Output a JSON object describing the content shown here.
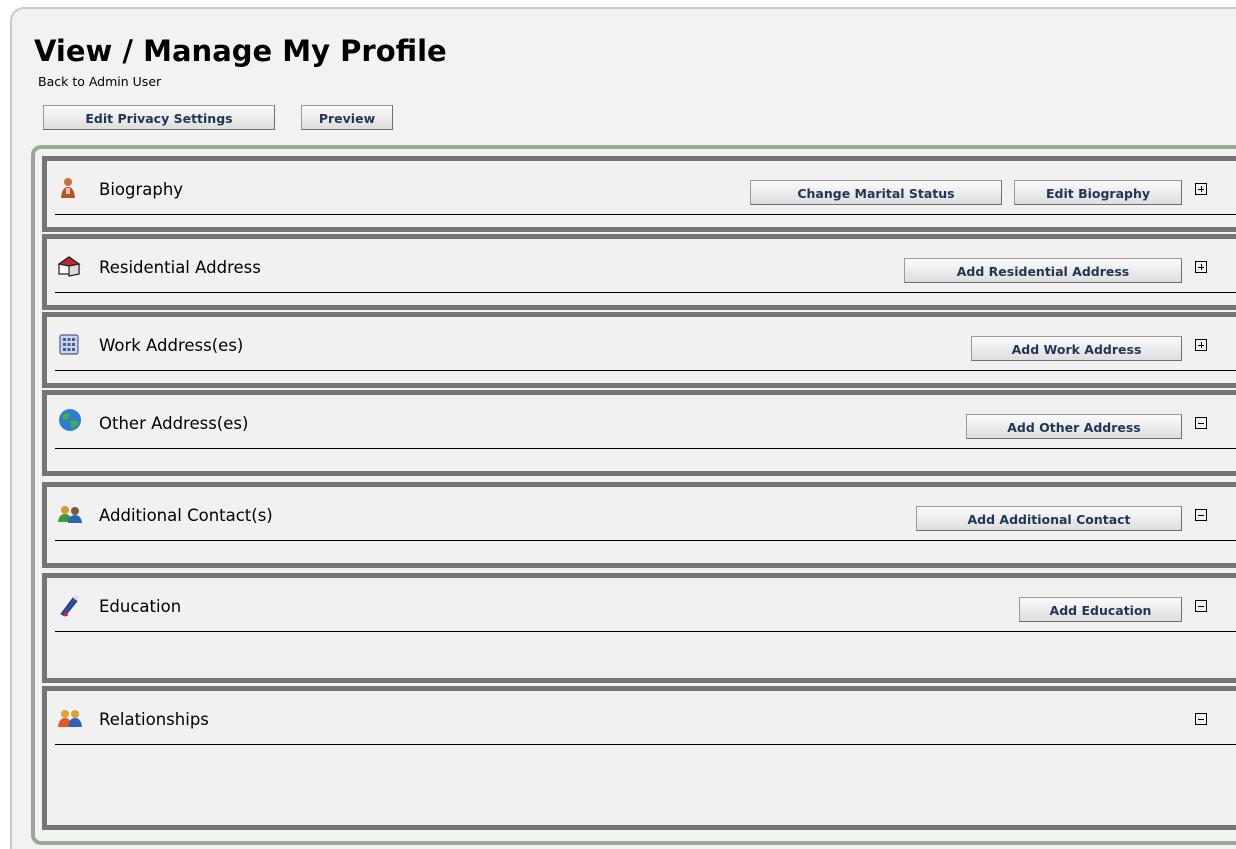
{
  "page": {
    "title": "View / Manage My Profile",
    "back_link": "Back to Admin User",
    "buttons": {
      "edit_privacy": "Edit Privacy Settings",
      "preview": "Preview"
    }
  },
  "sections": [
    {
      "title": "Biography",
      "icon": "person-icon",
      "state": "collapsed",
      "buttons": [
        "Change Marital Status",
        "Edit Biography"
      ]
    },
    {
      "title": "Residential Address",
      "icon": "house-icon",
      "state": "collapsed",
      "buttons": [
        "Add Residential Address"
      ]
    },
    {
      "title": "Work Address(es)",
      "icon": "building-icon",
      "state": "collapsed",
      "buttons": [
        "Add Work Address"
      ]
    },
    {
      "title": "Other Address(es)",
      "icon": "globe-icon",
      "state": "expanded",
      "buttons": [
        "Add Other Address"
      ]
    },
    {
      "title": "Additional Contact(s)",
      "icon": "contacts-icon",
      "state": "expanded",
      "buttons": [
        "Add Additional Contact"
      ]
    },
    {
      "title": "Education",
      "icon": "diploma-icon",
      "state": "expanded",
      "buttons": [
        "Add Education"
      ]
    },
    {
      "title": "Relationships",
      "icon": "people-icon",
      "state": "expanded",
      "buttons": []
    }
  ],
  "colors": {
    "button_text": "#1f3656",
    "section_border": "#757575",
    "outer_border": "#98a995"
  }
}
